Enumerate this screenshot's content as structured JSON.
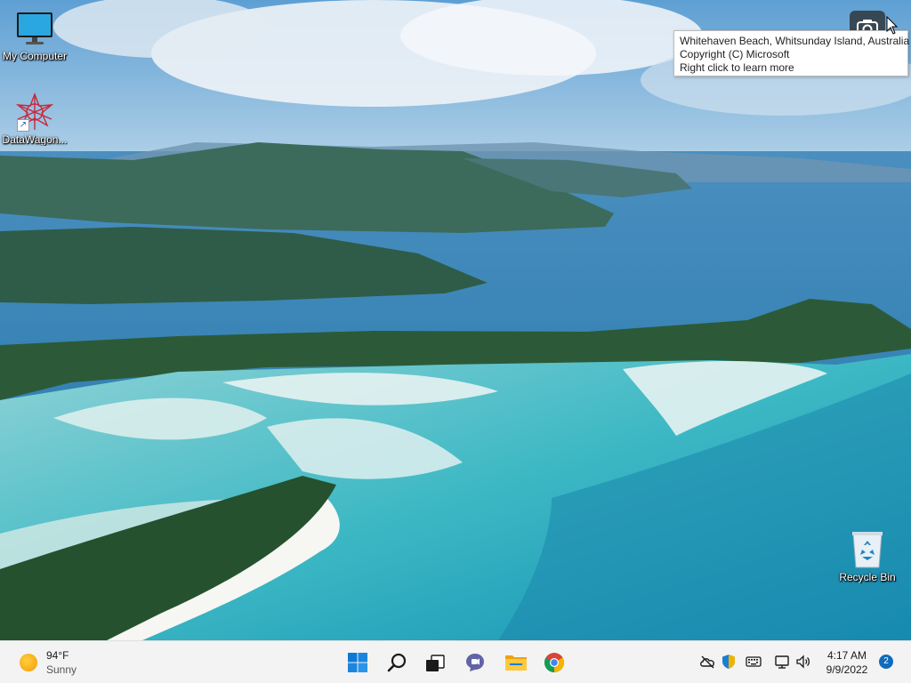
{
  "desktop": {
    "icons": [
      {
        "label": "My Computer"
      },
      {
        "label": "DataWagon..."
      },
      {
        "label": "Recycle Bin"
      }
    ]
  },
  "spotlight": {
    "icon": "camera-icon",
    "tooltip": {
      "line1": "Whitehaven Beach, Whitsunday Island, Australia",
      "line2": "Copyright (C) Microsoft",
      "line3": "Right click to learn more"
    }
  },
  "taskbar": {
    "weather": {
      "temp": "94°F",
      "condition": "Sunny",
      "icon": "sun-icon"
    },
    "apps": [
      {
        "name": "start",
        "icon": "windows-logo-icon"
      },
      {
        "name": "search",
        "icon": "search-icon"
      },
      {
        "name": "task-view",
        "icon": "task-view-icon"
      },
      {
        "name": "chat",
        "icon": "teams-chat-icon"
      },
      {
        "name": "file-explorer",
        "icon": "folder-icon"
      },
      {
        "name": "chrome",
        "icon": "chrome-icon"
      }
    ],
    "tray": {
      "time": "4:17 AM",
      "date": "9/9/2022",
      "notifications": "2"
    }
  },
  "colors": {
    "taskbar_bg": "#f3f3f3",
    "accent": "#0f6cbd"
  }
}
